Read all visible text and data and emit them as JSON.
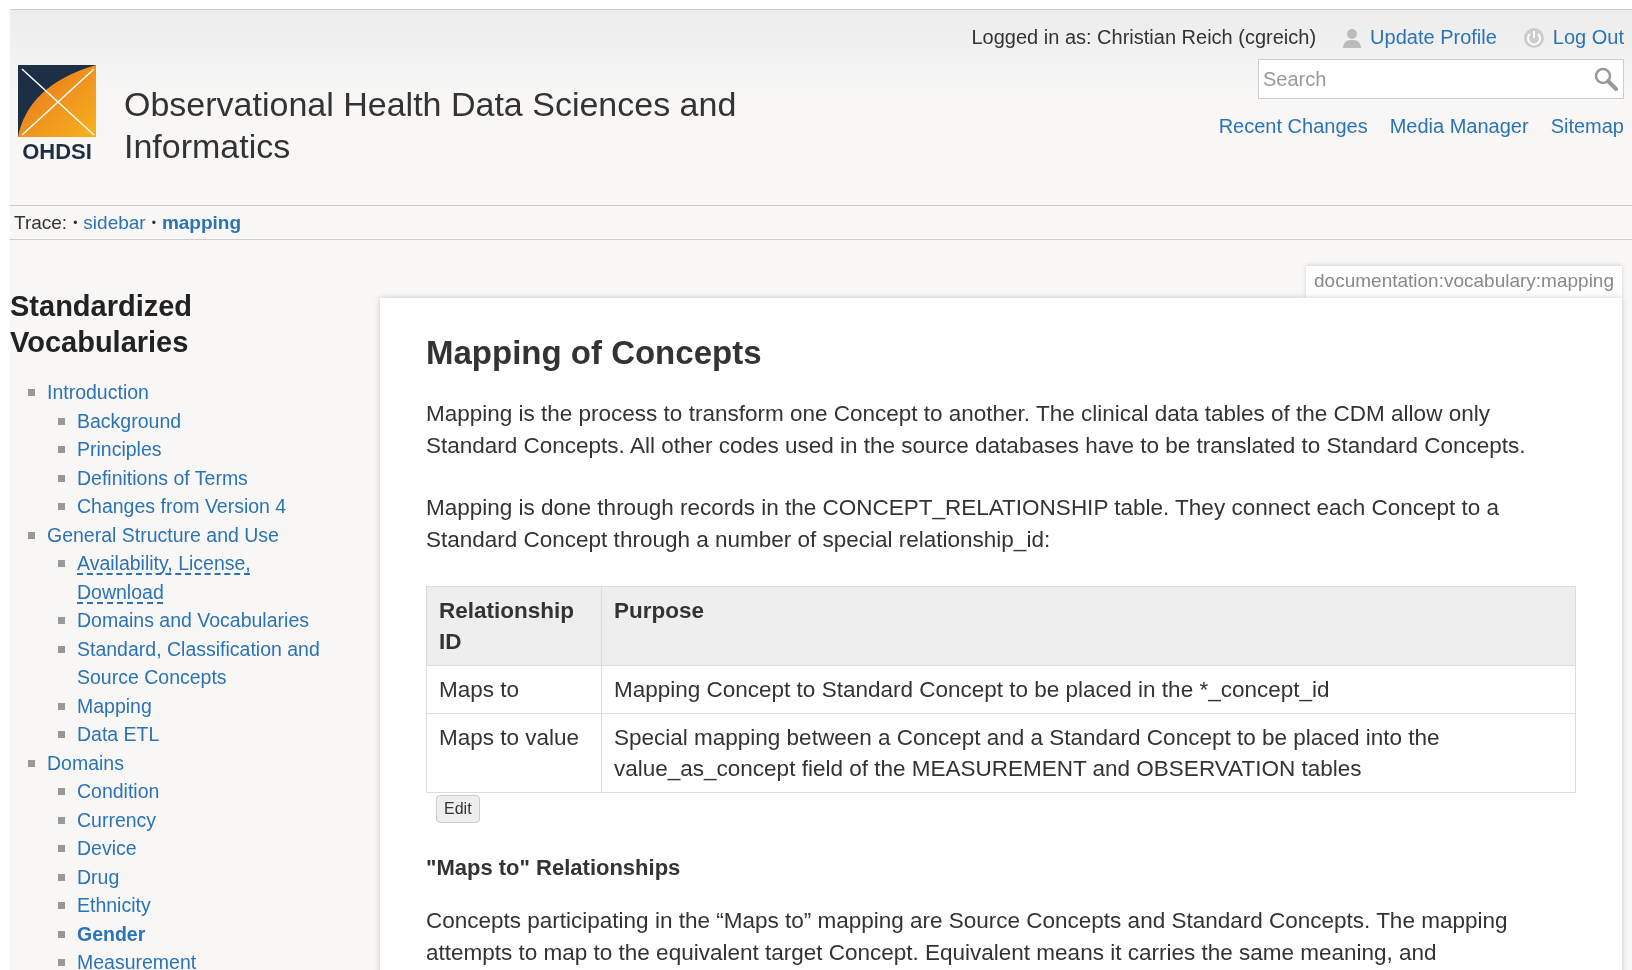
{
  "header": {
    "site_title": "Observational Health Data Sciences and Informatics",
    "logo_text": "OHDSI",
    "user_info": "Logged in as: Christian Reich (cgreich)",
    "user_links": [
      "Update Profile",
      "Log Out"
    ],
    "search": {
      "placeholder": "Search"
    },
    "nav_links": [
      "Recent Changes",
      "Media Manager",
      "Sitemap"
    ]
  },
  "trace": {
    "label": "Trace:",
    "separator": "•",
    "items": [
      {
        "label": "sidebar",
        "selected": false
      },
      {
        "label": "mapping",
        "selected": true
      }
    ]
  },
  "sidebar": {
    "title": "Standardized Vocabularies",
    "items": [
      {
        "label": "Introduction",
        "selected": false,
        "exists": true,
        "children": [
          {
            "label": "Background",
            "selected": false,
            "exists": true
          },
          {
            "label": "Principles",
            "selected": false,
            "exists": true
          },
          {
            "label": "Definitions of Terms",
            "selected": false,
            "exists": true
          },
          {
            "label": "Changes from Version 4",
            "selected": false,
            "exists": true
          }
        ]
      },
      {
        "label": "General Structure and Use",
        "selected": false,
        "exists": true,
        "children": [
          {
            "label": "Availability, License, Download",
            "selected": false,
            "exists": false
          },
          {
            "label": "Domains and Vocabularies",
            "selected": false,
            "exists": true
          },
          {
            "label": "Standard, Classification and Source Concepts",
            "selected": false,
            "exists": true
          },
          {
            "label": "Mapping",
            "selected": false,
            "exists": true
          },
          {
            "label": "Data ETL",
            "selected": false,
            "exists": true
          }
        ]
      },
      {
        "label": "Domains",
        "selected": false,
        "exists": true,
        "children": [
          {
            "label": "Condition",
            "selected": false,
            "exists": true
          },
          {
            "label": "Currency",
            "selected": false,
            "exists": true
          },
          {
            "label": "Device",
            "selected": false,
            "exists": true
          },
          {
            "label": "Drug",
            "selected": false,
            "exists": true
          },
          {
            "label": "Ethnicity",
            "selected": false,
            "exists": true
          },
          {
            "label": "Gender",
            "selected": true,
            "exists": true
          },
          {
            "label": "Measurement",
            "selected": false
          }
        ]
      }
    ]
  },
  "page_id": "documentation:vocabulary:mapping",
  "content": {
    "heading": "Mapping of Concepts",
    "paragraphs": [
      "Mapping is the process to transform one Concept to another. The clinical data tables of the CDM allow only Standard Concepts. All other codes used in the source databases have to be translated to Standard Concepts.",
      "Mapping is done through records in the CONCEPT_RELATIONSHIP table. They connect each Concept to a Standard Concept through a number of special relationship_id:"
    ],
    "table": {
      "columns": [
        "Relationship ID",
        "Purpose"
      ],
      "rows": [
        [
          "Maps to",
          "Mapping Concept to Standard Concept to be placed in the *_concept_id"
        ],
        [
          "Maps to value",
          "Special mapping between a Concept and a Standard Concept to be placed into the value_as_concept field of the MEASUREMENT and OBSERVATION tables"
        ]
      ]
    },
    "edit_button": "Edit",
    "subheading": "\"Maps to\" Relationships",
    "paragraphs_2": [
      "Concepts participating in the “Maps to” mapping are Source Concepts and Standard Concepts. The mapping attempts to map to the equivalent target Concept. Equivalent means it carries the same meaning, and"
    ]
  }
}
